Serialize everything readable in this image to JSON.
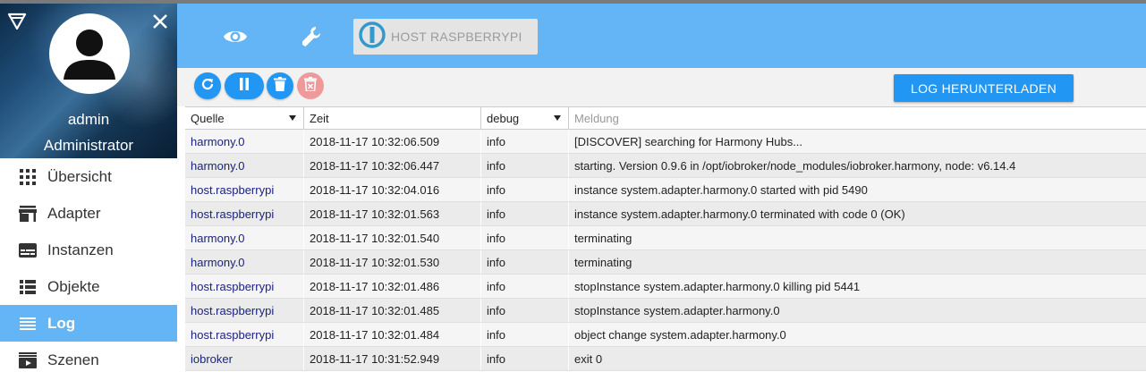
{
  "user": {
    "name": "admin",
    "role": "Administrator"
  },
  "nav": [
    {
      "id": "uebersicht",
      "label": "Übersicht",
      "icon": "grid-icon",
      "active": false
    },
    {
      "id": "adapter",
      "label": "Adapter",
      "icon": "store-icon",
      "active": false
    },
    {
      "id": "instanzen",
      "label": "Instanzen",
      "icon": "instances-icon",
      "active": false
    },
    {
      "id": "objekte",
      "label": "Objekte",
      "icon": "list-icon",
      "active": false
    },
    {
      "id": "log",
      "label": "Log",
      "icon": "log-icon",
      "active": true
    },
    {
      "id": "szenen",
      "label": "Szenen",
      "icon": "scenes-icon",
      "active": false
    }
  ],
  "header": {
    "host_label": "HOST RASPBERRYPI"
  },
  "toolbar": {
    "download_label": "LOG HERUNTERLADEN"
  },
  "colors": {
    "accent": "#64b5f6",
    "button": "#2196f3",
    "disabled": "#ef9a9a",
    "source_text": "#1a237e"
  },
  "table": {
    "headers": {
      "source": "Quelle",
      "time": "Zeit",
      "level": "debug",
      "message_placeholder": "Meldung"
    },
    "rows": [
      {
        "source": "harmony.0",
        "time": "2018-11-17 10:32:06.509",
        "level": "info",
        "message": "[DISCOVER] searching for Harmony Hubs..."
      },
      {
        "source": "harmony.0",
        "time": "2018-11-17 10:32:06.447",
        "level": "info",
        "message": "starting. Version 0.9.6 in /opt/iobroker/node_modules/iobroker.harmony, node: v6.14.4"
      },
      {
        "source": "host.raspberrypi",
        "time": "2018-11-17 10:32:04.016",
        "level": "info",
        "message": "instance system.adapter.harmony.0 started with pid 5490"
      },
      {
        "source": "host.raspberrypi",
        "time": "2018-11-17 10:32:01.563",
        "level": "info",
        "message": "instance system.adapter.harmony.0 terminated with code 0 (OK)"
      },
      {
        "source": "harmony.0",
        "time": "2018-11-17 10:32:01.540",
        "level": "info",
        "message": "terminating"
      },
      {
        "source": "harmony.0",
        "time": "2018-11-17 10:32:01.530",
        "level": "info",
        "message": "terminating"
      },
      {
        "source": "host.raspberrypi",
        "time": "2018-11-17 10:32:01.486",
        "level": "info",
        "message": "stopInstance system.adapter.harmony.0 killing pid 5441"
      },
      {
        "source": "host.raspberrypi",
        "time": "2018-11-17 10:32:01.485",
        "level": "info",
        "message": "stopInstance system.adapter.harmony.0"
      },
      {
        "source": "host.raspberrypi",
        "time": "2018-11-17 10:32:01.484",
        "level": "info",
        "message": "object change system.adapter.harmony.0"
      },
      {
        "source": "iobroker",
        "time": "2018-11-17 10:31:52.949",
        "level": "info",
        "message": "exit 0"
      }
    ]
  }
}
